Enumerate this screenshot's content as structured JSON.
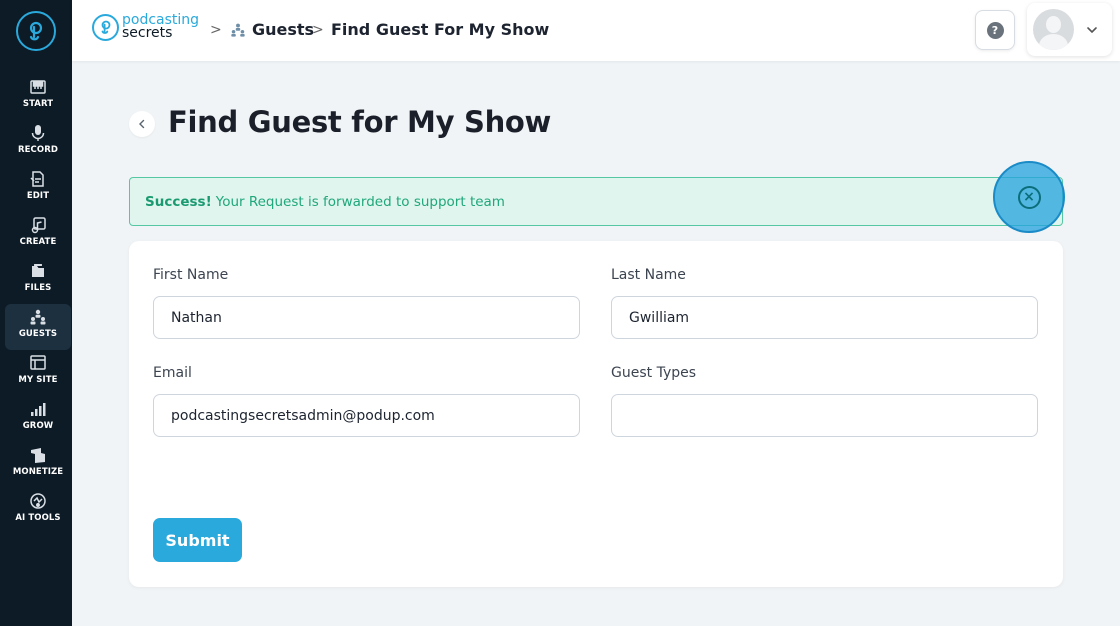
{
  "sidebar": {
    "items": [
      {
        "label": "START",
        "icon": "piano-icon"
      },
      {
        "label": "RECORD",
        "icon": "microphone-icon"
      },
      {
        "label": "EDIT",
        "icon": "edit-file-icon"
      },
      {
        "label": "CREATE",
        "icon": "create-music-icon"
      },
      {
        "label": "FILES",
        "icon": "files-icon"
      },
      {
        "label": "GUESTS",
        "icon": "guests-icon",
        "active": true
      },
      {
        "label": "MY SITE",
        "icon": "website-icon"
      },
      {
        "label": "GROW",
        "icon": "bar-chart-icon"
      },
      {
        "label": "MONETIZE",
        "icon": "monetize-icon"
      },
      {
        "label": "AI TOOLS",
        "icon": "ai-tools-icon"
      }
    ]
  },
  "header": {
    "brand_line1": "podcasting",
    "brand_line2": "secrets",
    "breadcrumb": {
      "separator": ">",
      "section": "Guests",
      "current": "Find Guest For My Show"
    },
    "help_label": "?"
  },
  "main": {
    "title": "Find Guest for My Show",
    "alert": {
      "strong": "Success!",
      "message": "Your Request is forwarded to support team",
      "close_symbol": "×"
    },
    "form": {
      "first_name_label": "First Name",
      "first_name_value": "Nathan",
      "last_name_label": "Last Name",
      "last_name_value": "Gwilliam",
      "email_label": "Email",
      "email_value": "podcastingsecretsadmin@podup.com",
      "guest_types_label": "Guest Types",
      "guest_types_value": "",
      "submit_label": "Submit"
    }
  },
  "colors": {
    "accent": "#2aa9dc",
    "sidebar_bg": "#0d1b26",
    "success_bg": "#dff5ee",
    "success_text": "#20a77b"
  }
}
